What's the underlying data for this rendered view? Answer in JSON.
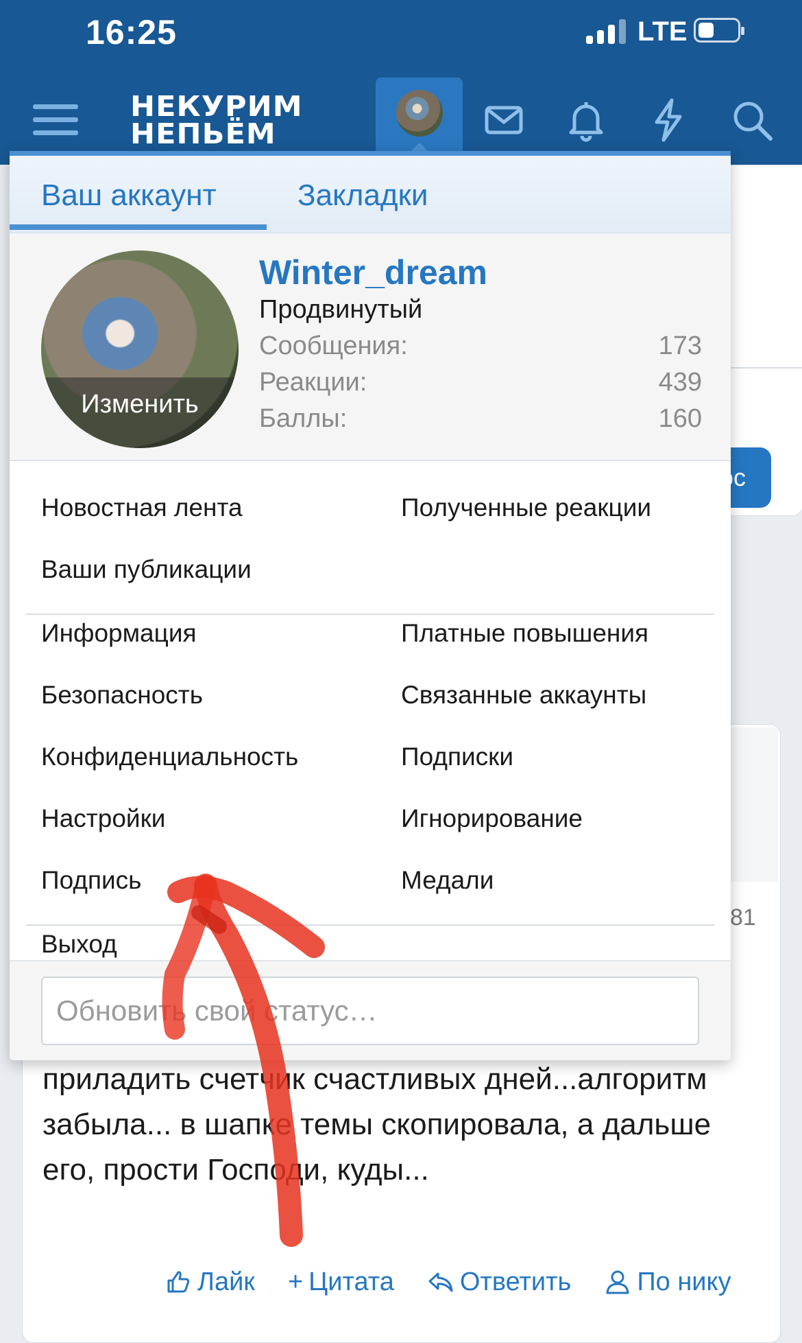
{
  "status_bar": {
    "time": "16:25",
    "network": "LTE"
  },
  "header": {
    "logo_line1": "НЕКУРИМ",
    "logo_line2": "НЕПЬЁМ",
    "icons": [
      "menu-icon",
      "avatar",
      "mail-icon",
      "bell-icon",
      "lightning-icon",
      "search-icon"
    ]
  },
  "menu": {
    "tabs": [
      {
        "label": "Ваш аккаунт",
        "active": true
      },
      {
        "label": "Закладки",
        "active": false
      }
    ],
    "profile": {
      "username": "Winter_dream",
      "rank": "Продвинутый",
      "avatar_edit": "Изменить",
      "stats": [
        {
          "label": "Сообщения:",
          "value": "173"
        },
        {
          "label": "Реакции:",
          "value": "439"
        },
        {
          "label": "Баллы:",
          "value": "160"
        }
      ]
    },
    "links": {
      "news_feed": "Новостная лента",
      "received_reactions": "Полученные реакции",
      "your_content": "Ваши публикации",
      "info": "Информация",
      "paid_upgrades": "Платные повышения",
      "security": "Безопасность",
      "connected_accounts": "Связанные аккаунты",
      "privacy": "Конфиденциальность",
      "following": "Подписки",
      "preferences": "Настройки",
      "ignoring": "Игнорирование",
      "signature": "Подпись",
      "medals": "Медали",
      "logout": "Выход"
    },
    "status_placeholder": "Обновить свой статус…"
  },
  "background": {
    "button_fragment": "ос",
    "number_fragment": "81",
    "post_text": "приладить счетчик счастливых дней...алгоритм забыла... в шапке темы скопировала, а дальше его, прости Господи, куды...",
    "actions": {
      "like": "Лайк",
      "quote": "Цитата",
      "reply": "Ответить",
      "by_nick": "По нику"
    }
  },
  "colors": {
    "header_bg": "#185894",
    "accent": "#2577c2",
    "annotation_arrow": "#e8331f"
  }
}
